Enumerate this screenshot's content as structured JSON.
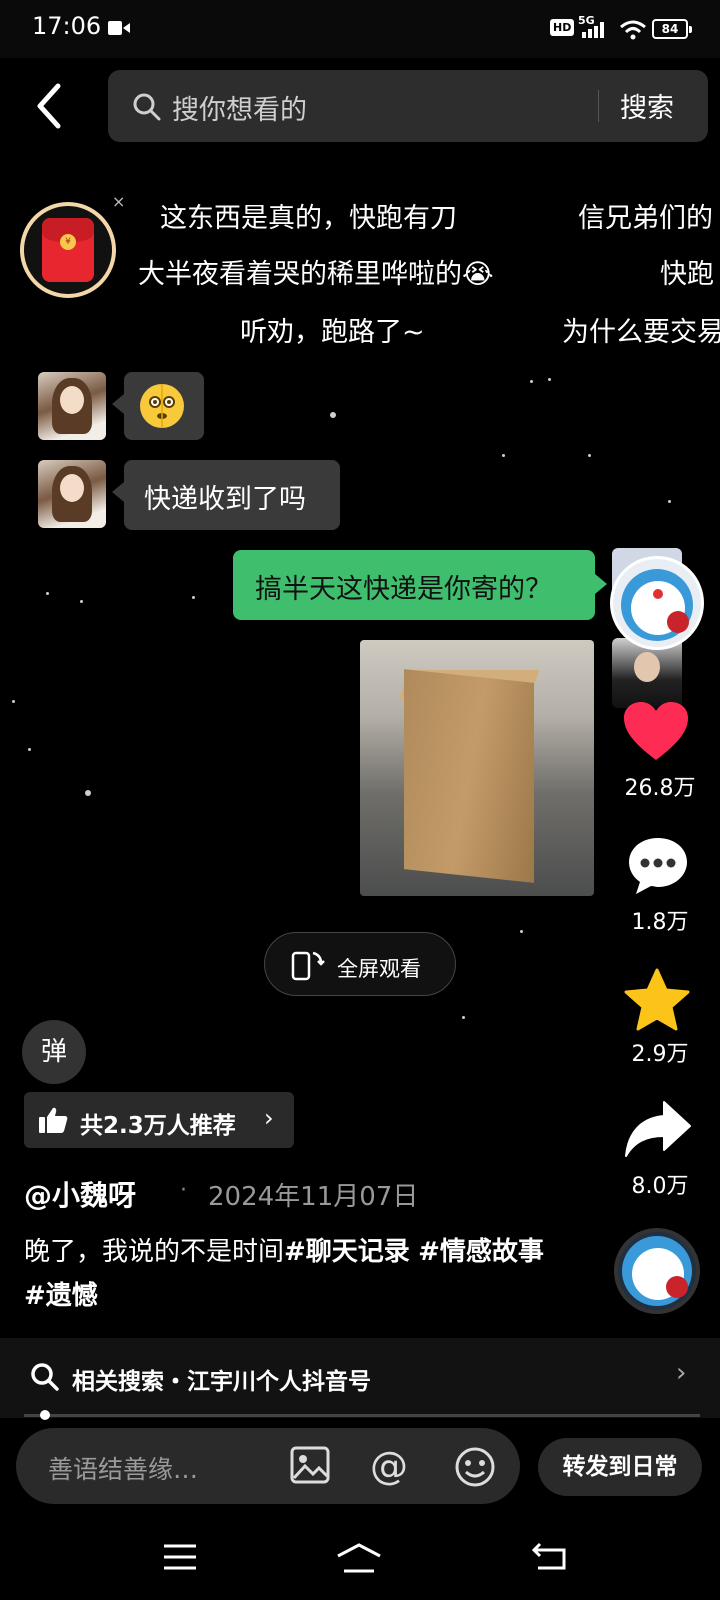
{
  "status_bar": {
    "time": "17:06",
    "hd": "HD",
    "network": "5G",
    "battery": "84"
  },
  "search": {
    "placeholder": "搜你想看的",
    "submit_label": "搜索"
  },
  "danmaku": [
    "这东西是真的，快跑有刀",
    "信兄弟们的",
    "大半夜看着哭的稀里哗啦的😭",
    "快跑",
    "听劝，跑路了~",
    "为什么要交易"
  ],
  "redpacket": {
    "coin": "¥",
    "close": "×"
  },
  "chat": {
    "incoming_emoji": "🫨",
    "incoming_text": "快递收到了吗",
    "outgoing_text": "搞半天这快递是你寄的？"
  },
  "actions": {
    "likes": "26.8万",
    "comments": "1.8万",
    "favorites": "2.9万",
    "shares": "8.0万"
  },
  "fullscreen_label": "全屏观看",
  "danmaku_toggle": "弹",
  "recommend": {
    "label": "共2.3万人推荐",
    "chevron": "›"
  },
  "post": {
    "author": "@小魏呀",
    "dot": "·",
    "date": "2024年11月07日",
    "caption_plain": "晚了，我说的不是时间",
    "tags": [
      "#聊天记录",
      "#情感故事",
      "#遗憾"
    ]
  },
  "related_search": {
    "label": "相关搜索・江宇川个人抖音号",
    "chevron": "›"
  },
  "comment_input": {
    "placeholder": "善语结善缘…",
    "at": "@"
  },
  "forward_label": "转发到日常",
  "colors": {
    "accent_green": "#3fbf6e",
    "like_red": "#fe2c55",
    "star_yellow": "#fcc419",
    "background": "#000000"
  },
  "icons": [
    "back-arrow",
    "search",
    "heart",
    "comment",
    "star",
    "share",
    "thumbs-up",
    "image",
    "smile",
    "menu",
    "home",
    "return"
  ]
}
